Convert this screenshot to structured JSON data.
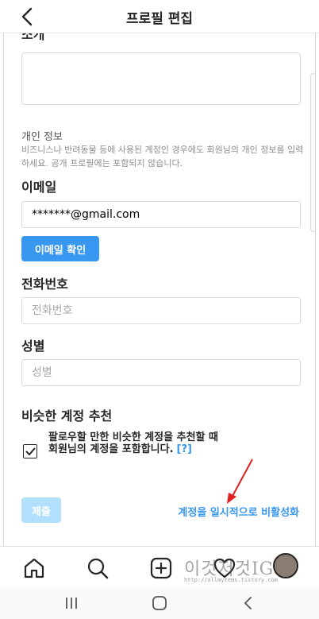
{
  "header": {
    "title": "프로필 편집"
  },
  "bio": {
    "section_label": "소개",
    "value": ""
  },
  "personal_info": {
    "title": "개인 정보",
    "description": "비즈니스나 반려동물 등에 사용된 계정인 경우에도 회원님의 개인 정보를 입력하세요. 공개 프로필에는 포함되지 않습니다."
  },
  "email": {
    "label": "이메일",
    "value": "*******@gmail.com",
    "verify_label": "이메일 확인"
  },
  "phone": {
    "label": "전화번호",
    "placeholder": "전화번호"
  },
  "gender": {
    "label": "성별",
    "placeholder": "성별"
  },
  "similar": {
    "title": "비슷한 계정 추천",
    "checkbox_text": "팔로우할 만한 비슷한 계정을 추천할 때 회원님의 계정을 포함합니다.",
    "help": "[?]",
    "checked": true
  },
  "actions": {
    "submit_label": "제출",
    "deactivate_label": "계정을 일시적으로 비활성화"
  },
  "watermark": {
    "main": "이것저것IG",
    "sub": "http://allmytems.tistory.com"
  },
  "colors": {
    "accent": "#3897f0",
    "accent_disabled": "#b2dffc",
    "arrow": "#e02020"
  }
}
